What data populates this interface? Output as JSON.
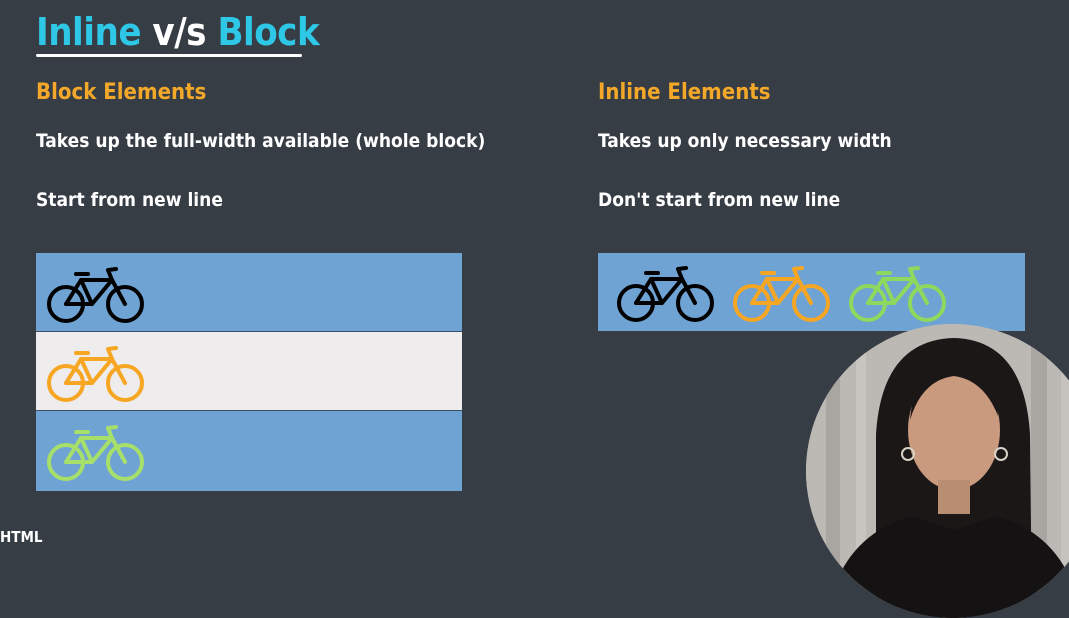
{
  "title": {
    "part1": "Inline",
    "part2": " v/s ",
    "part3": "Block"
  },
  "block": {
    "heading": "Block Elements",
    "line1": "Takes up the full-width available (whole block)",
    "line2": "Start from new line"
  },
  "inline": {
    "heading": "Inline Elements",
    "line1": "Takes up only necessary width",
    "line2": "Don't start from new line"
  },
  "footer_cut_text": "HTML",
  "colors": {
    "background": "#363d45",
    "title_accent": "#2ec7e6",
    "heading": "#f3a82a",
    "box_blue": "#6fa3d4",
    "box_light": "#eeeced",
    "bike_black": "#000000",
    "bike_orange": "#f6a623",
    "bike_green": "#a6e06a",
    "bike_green_inline": "#8ed85e"
  },
  "icons": [
    "bicycle-icon"
  ]
}
